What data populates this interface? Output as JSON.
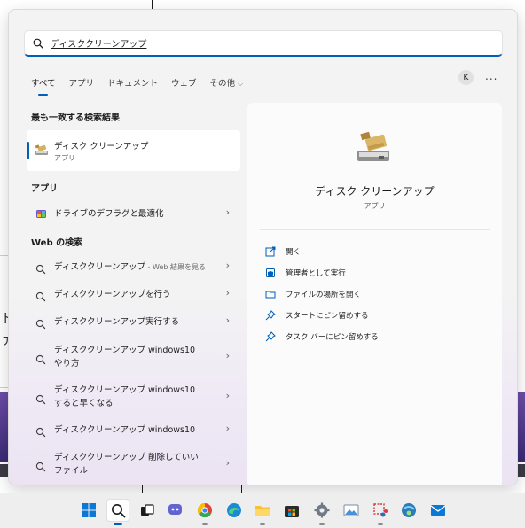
{
  "search": {
    "query": "ディスククリーンアップ",
    "placeholder": ""
  },
  "tabs": [
    {
      "label": "すべて",
      "active": true
    },
    {
      "label": "アプリ"
    },
    {
      "label": "ドキュメント"
    },
    {
      "label": "ウェブ"
    },
    {
      "label": "その他"
    }
  ],
  "account": {
    "initial": "K",
    "more": "..."
  },
  "best_match": {
    "heading": "最も一致する検索結果",
    "name": "ディスク クリーンアップ",
    "type": "アプリ"
  },
  "apps": {
    "heading": "アプリ",
    "items": [
      {
        "label": "ドライブのデフラグと最適化"
      }
    ]
  },
  "web": {
    "heading": "Web の検索",
    "items": [
      {
        "label": "ディスククリーンアップ",
        "suffix": " - Web 結果を見る"
      },
      {
        "label": "ディスククリーンアップを行う"
      },
      {
        "label": "ディスククリーンアップ実行する"
      },
      {
        "label": "ディスククリーンアップ windows10 やり方"
      },
      {
        "label": "ディスククリーンアップ windows10 すると早くなる"
      },
      {
        "label": "ディスククリーンアップ windows10"
      },
      {
        "label": "ディスククリーンアップ 削除していいファイル"
      }
    ]
  },
  "preview": {
    "title": "ディスク クリーンアップ",
    "type": "アプリ",
    "actions": [
      {
        "label": "開く",
        "icon": "open-icon"
      },
      {
        "label": "管理者として実行",
        "icon": "shield-icon"
      },
      {
        "label": "ファイルの場所を開く",
        "icon": "folder-icon"
      },
      {
        "label": "スタートにピン留めする",
        "icon": "pin-icon"
      },
      {
        "label": "タスク バーにピン留めする",
        "icon": "pin-icon"
      }
    ]
  },
  "taskbar": {
    "icons": [
      "windows-start-icon",
      "search-icon",
      "task-view-icon",
      "chat-icon",
      "chrome-icon",
      "edge-icon",
      "file-explorer-icon",
      "microsoft-store-icon",
      "settings-icon",
      "photos-icon",
      "snipping-tool-icon",
      "network-icon",
      "mail-icon"
    ]
  },
  "desktop": {
    "fragment_1": "ド",
    "fragment_2": "ァ"
  },
  "colors": {
    "accent": "#005fb8",
    "flyout_bg": "#f3f3f3",
    "taskbar_bg": "#eeeeee"
  }
}
